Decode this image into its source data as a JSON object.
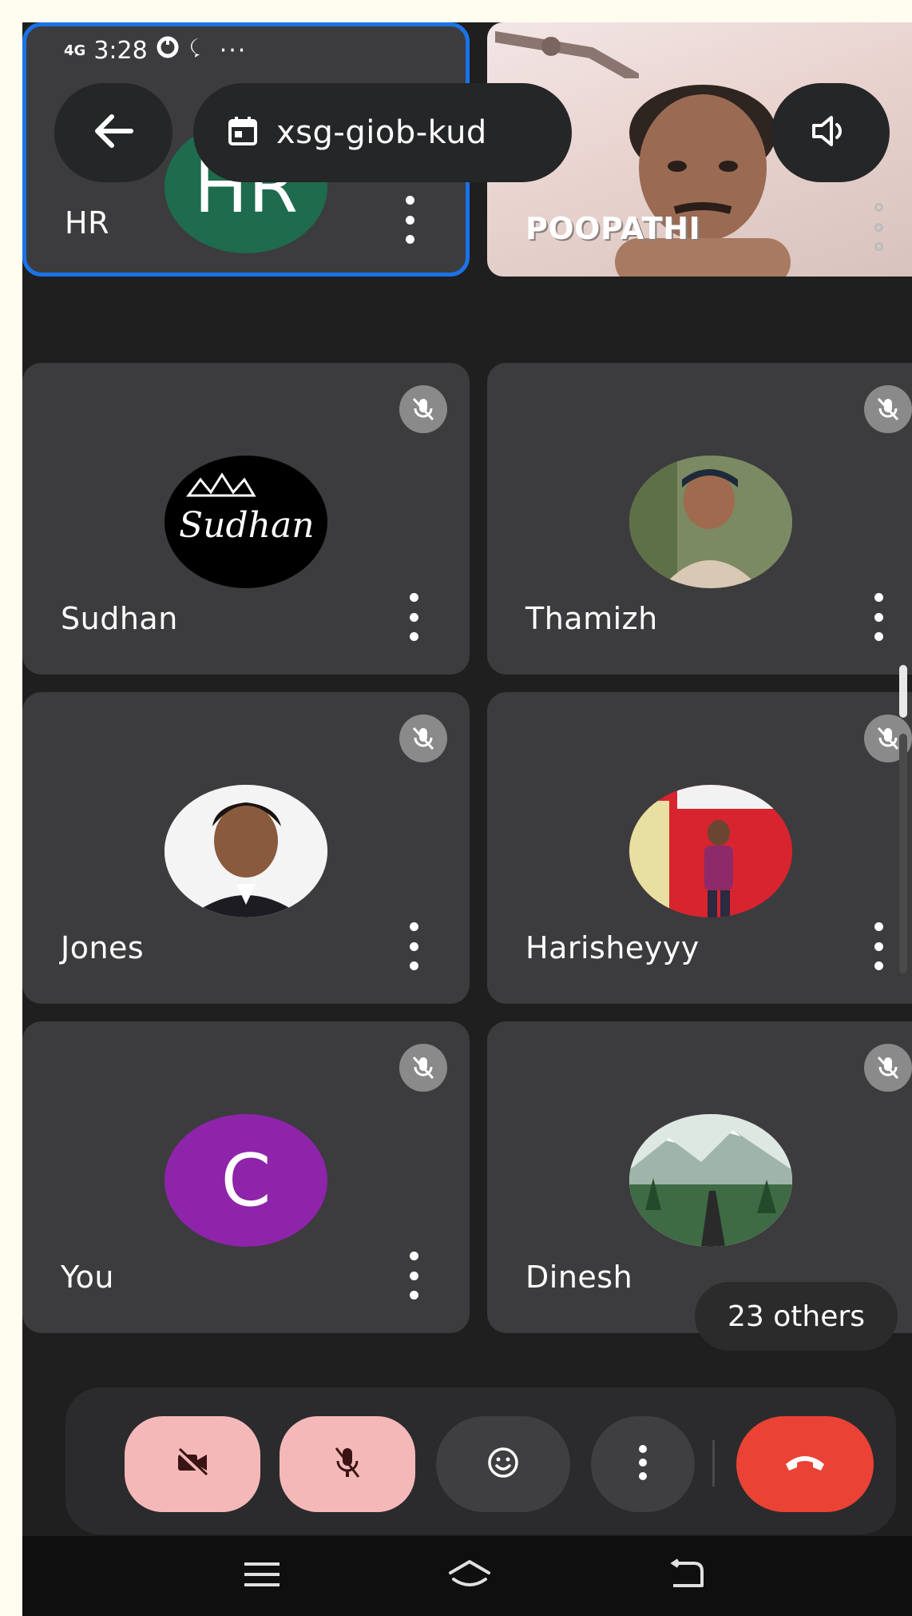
{
  "status_bar": {
    "signal": "4G",
    "time": "3:28",
    "more": "···"
  },
  "meeting": {
    "code": "xsg-giob-kud"
  },
  "tiles": [
    {
      "name": "HR",
      "avatar_text": "HR",
      "avatar_color": "#1e6b4e",
      "active": true
    },
    {
      "name": "POOPATHI",
      "video": true
    },
    {
      "name": "Sudhan",
      "avatar_text": "Sudhan",
      "muted": true
    },
    {
      "name": "Thamizh",
      "muted": true
    },
    {
      "name": "Jones",
      "muted": true
    },
    {
      "name": "Harisheyyy",
      "muted": true
    },
    {
      "name": "You",
      "avatar_text": "C",
      "avatar_color": "#8e24aa",
      "muted": true
    },
    {
      "name": "Dinesh",
      "muted": true
    }
  ],
  "others": {
    "label": "23 others"
  },
  "controls": {
    "camera_off_color": "#f5b8b8",
    "mic_off_color": "#f5b8b8",
    "hangup_color": "#ea4335"
  },
  "colors": {
    "background": "#1f1f1f",
    "tile": "#3c3c3e",
    "active_border": "#1a73e8"
  }
}
